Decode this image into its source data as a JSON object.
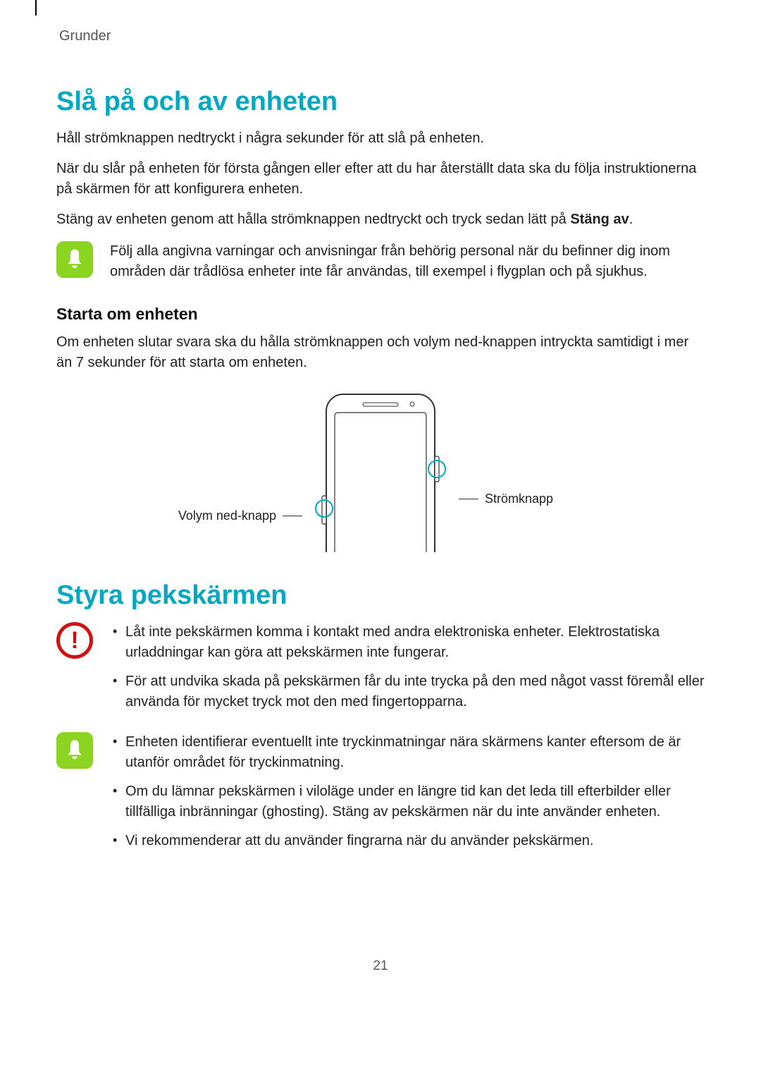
{
  "breadcrumb": "Grunder",
  "section1": {
    "title": "Slå på och av enheten",
    "para1": "Håll strömknappen nedtryckt i några sekunder för att slå på enheten.",
    "para2": "När du slår på enheten för första gången eller efter att du har återställt data ska du följa instruktionerna på skärmen för att konfigurera enheten.",
    "para3_pre": "Stäng av enheten genom att hålla strömknappen nedtryckt och tryck sedan lätt på ",
    "para3_bold": "Stäng av",
    "para3_post": ".",
    "note": "Följ alla angivna varningar och anvisningar från behörig personal när du befinner dig inom områden där trådlösa enheter inte får användas, till exempel i flygplan och på sjukhus.",
    "sub_title": "Starta om enheten",
    "sub_para": "Om enheten slutar svara ska du hålla strömknappen och volym ned-knappen intryckta samtidigt i mer än 7 sekunder för att starta om enheten.",
    "figure": {
      "label_left": "Volym ned-knapp",
      "label_right": "Strömknapp"
    }
  },
  "section2": {
    "title": "Styra pekskärmen",
    "warn_bullets": [
      "Låt inte pekskärmen komma i kontakt med andra elektroniska enheter. Elektrostatiska urladdningar kan göra att pekskärmen inte fungerar.",
      "För att undvika skada på pekskärmen får du inte trycka på den med något vasst föremål eller använda för mycket tryck mot den med fingertopparna."
    ],
    "info_bullets": [
      "Enheten identifierar eventuellt inte tryckinmatningar nära skärmens kanter eftersom de är utanför området för tryckinmatning.",
      "Om du lämnar pekskärmen i viloläge under en längre tid kan det leda till efterbilder eller tillfälliga inbränningar (ghosting). Stäng av pekskärmen när du inte använder enheten.",
      "Vi rekommenderar att du använder fingrarna när du använder pekskärmen."
    ]
  },
  "page_number": "21"
}
